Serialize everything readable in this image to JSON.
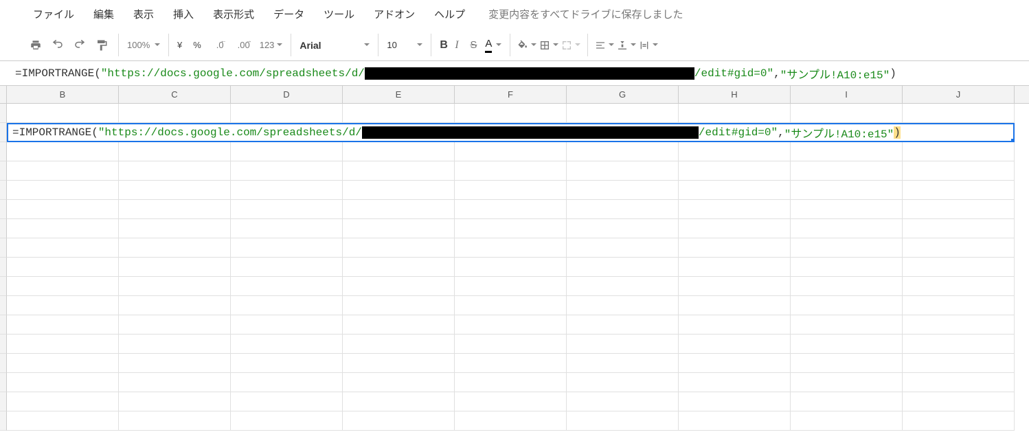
{
  "menu": {
    "file": "ファイル",
    "edit": "編集",
    "view": "表示",
    "insert": "挿入",
    "format": "表示形式",
    "data": "データ",
    "tools": "ツール",
    "addons": "アドオン",
    "help": "ヘルプ",
    "status": "変更内容をすべてドライブに保存しました"
  },
  "toolbar": {
    "zoom": "100%",
    "currency": "¥",
    "percent": "%",
    "dec_dec": ".0",
    "dec_inc": ".00",
    "num_format": "123",
    "font": "Arial",
    "size": "10",
    "bold": "B",
    "italic": "I",
    "strike": "S",
    "textcolor": "A"
  },
  "formula": {
    "prefix": "=IMPORTRANGE(",
    "arg1_a": "\"https://docs.google.com/spreadsheets/d/",
    "arg1_b": "/edit#gid=0\"",
    "sep": ",",
    "arg2": "\"サンプル!A10:e15\"",
    "suffix": ")"
  },
  "columns": [
    "B",
    "C",
    "D",
    "E",
    "F",
    "G",
    "H",
    "I",
    "J"
  ]
}
